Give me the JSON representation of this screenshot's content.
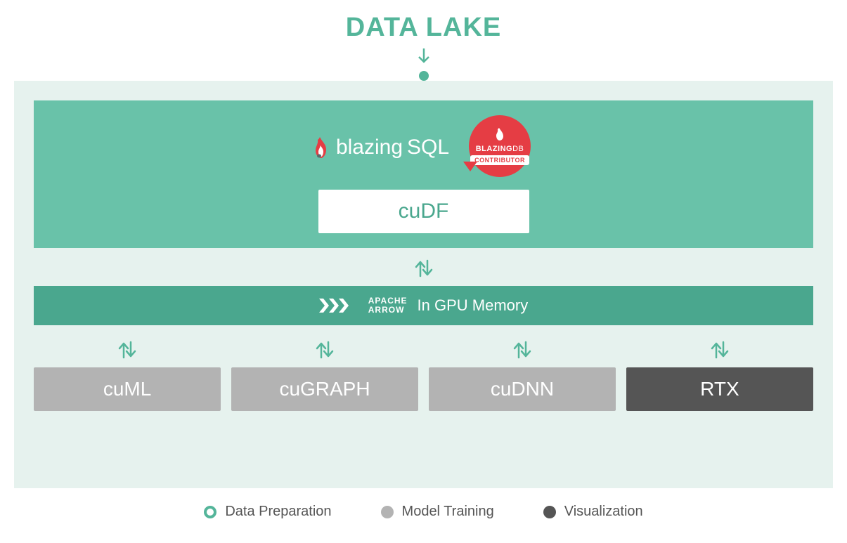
{
  "title": "DATA LAKE",
  "top": {
    "brand_prefix": "blazing",
    "brand_suffix": "SQL",
    "badge_name_bold": "BLAZING",
    "badge_name_light": "DB",
    "badge_label": "CONTRIBUTOR",
    "cudf": "cuDF"
  },
  "arrow_bar": {
    "apache_top": "APACHE",
    "apache_bottom": "ARROW",
    "label": "In GPU Memory"
  },
  "bottom": [
    {
      "label": "cuML",
      "style": "grey"
    },
    {
      "label": "cuGRAPH",
      "style": "grey"
    },
    {
      "label": "cuDNN",
      "style": "grey"
    },
    {
      "label": "RTX",
      "style": "dark"
    }
  ],
  "legend": {
    "prep": "Data Preparation",
    "train": "Model Training",
    "viz": "Visualization"
  }
}
